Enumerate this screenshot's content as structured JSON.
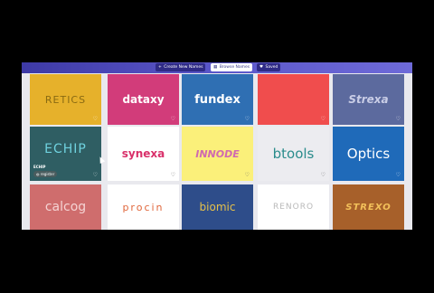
{
  "nav": {
    "create_label": "Create New Names",
    "browse_label": "Browse Names",
    "saved_label": "Saved"
  },
  "cards": [
    {
      "name": "RETICS",
      "bg": "#e6b12b",
      "fg": "#8a6a12"
    },
    {
      "name": "dataxy",
      "bg": "#d23c7a",
      "fg": "#ffffff"
    },
    {
      "name": "fundex",
      "bg": "#2f6fb3",
      "fg": "#ffffff"
    },
    {
      "name": "",
      "bg": "#f04d4d",
      "fg": "#f04d4d"
    },
    {
      "name": "Strexa",
      "bg": "#5c6a9e",
      "fg": "#c9cde6"
    },
    {
      "name": "ECHIP",
      "bg": "#2f5e63",
      "fg": "#6fd2df",
      "overlay_label": "ECHIP",
      "overlay_button": "register"
    },
    {
      "name": "synexa",
      "bg": "#ffffff",
      "fg": "#d9306a"
    },
    {
      "name": "INNODE",
      "bg": "#fbf07a",
      "fg": "#d06ab0"
    },
    {
      "name": "btools",
      "bg": "#ececf0",
      "fg": "#2a8c8c"
    },
    {
      "name": "Optics",
      "bg": "#1f6ab9",
      "fg": "#ffffff"
    },
    {
      "name": "calcog",
      "bg": "#cf6d6d",
      "fg": "#f5d3d3"
    },
    {
      "name": "procin",
      "bg": "#ffffff",
      "fg": "#e0663a"
    },
    {
      "name": "biomic",
      "bg": "#2e4d8a",
      "fg": "#e5c04a"
    },
    {
      "name": "RENORO",
      "bg": "#ffffff",
      "fg": "#b9b9b9"
    },
    {
      "name": "STREXO",
      "bg": "#a7602a",
      "fg": "#f2c05a"
    }
  ]
}
